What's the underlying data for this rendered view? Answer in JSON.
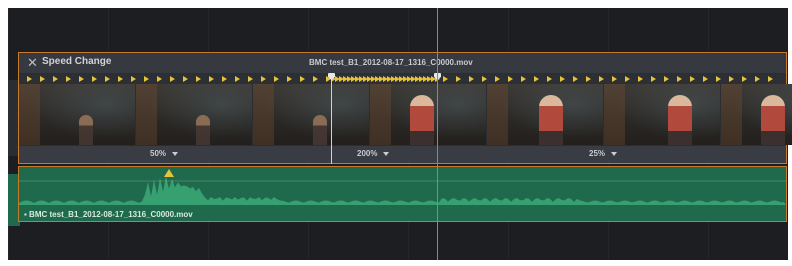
{
  "video_clip": {
    "effect_title": "Speed Change",
    "close_glyph": "✕",
    "clip_name": "BMC test_B1_2012-08-17_1316_C0000.mov",
    "speed_segments": [
      {
        "label": "50%"
      },
      {
        "label": "200%"
      },
      {
        "label": "25%"
      }
    ]
  },
  "audio_clip": {
    "clip_name": "▪ BMC test_B1_2012-08-17_1316_C0000.mov"
  },
  "colors": {
    "panel_bg": "#1c1e21",
    "clip_border": "#c77a2a",
    "speed_marker": "#e7c23a",
    "audio_clip": "#1f6a4c",
    "waveform": "#3fb37c",
    "playhead": "#c77a2a"
  },
  "icons": {
    "close": "close-icon",
    "speed_marker": "speed-marker-icon",
    "segment_dropdown": "chevron-down-icon"
  }
}
